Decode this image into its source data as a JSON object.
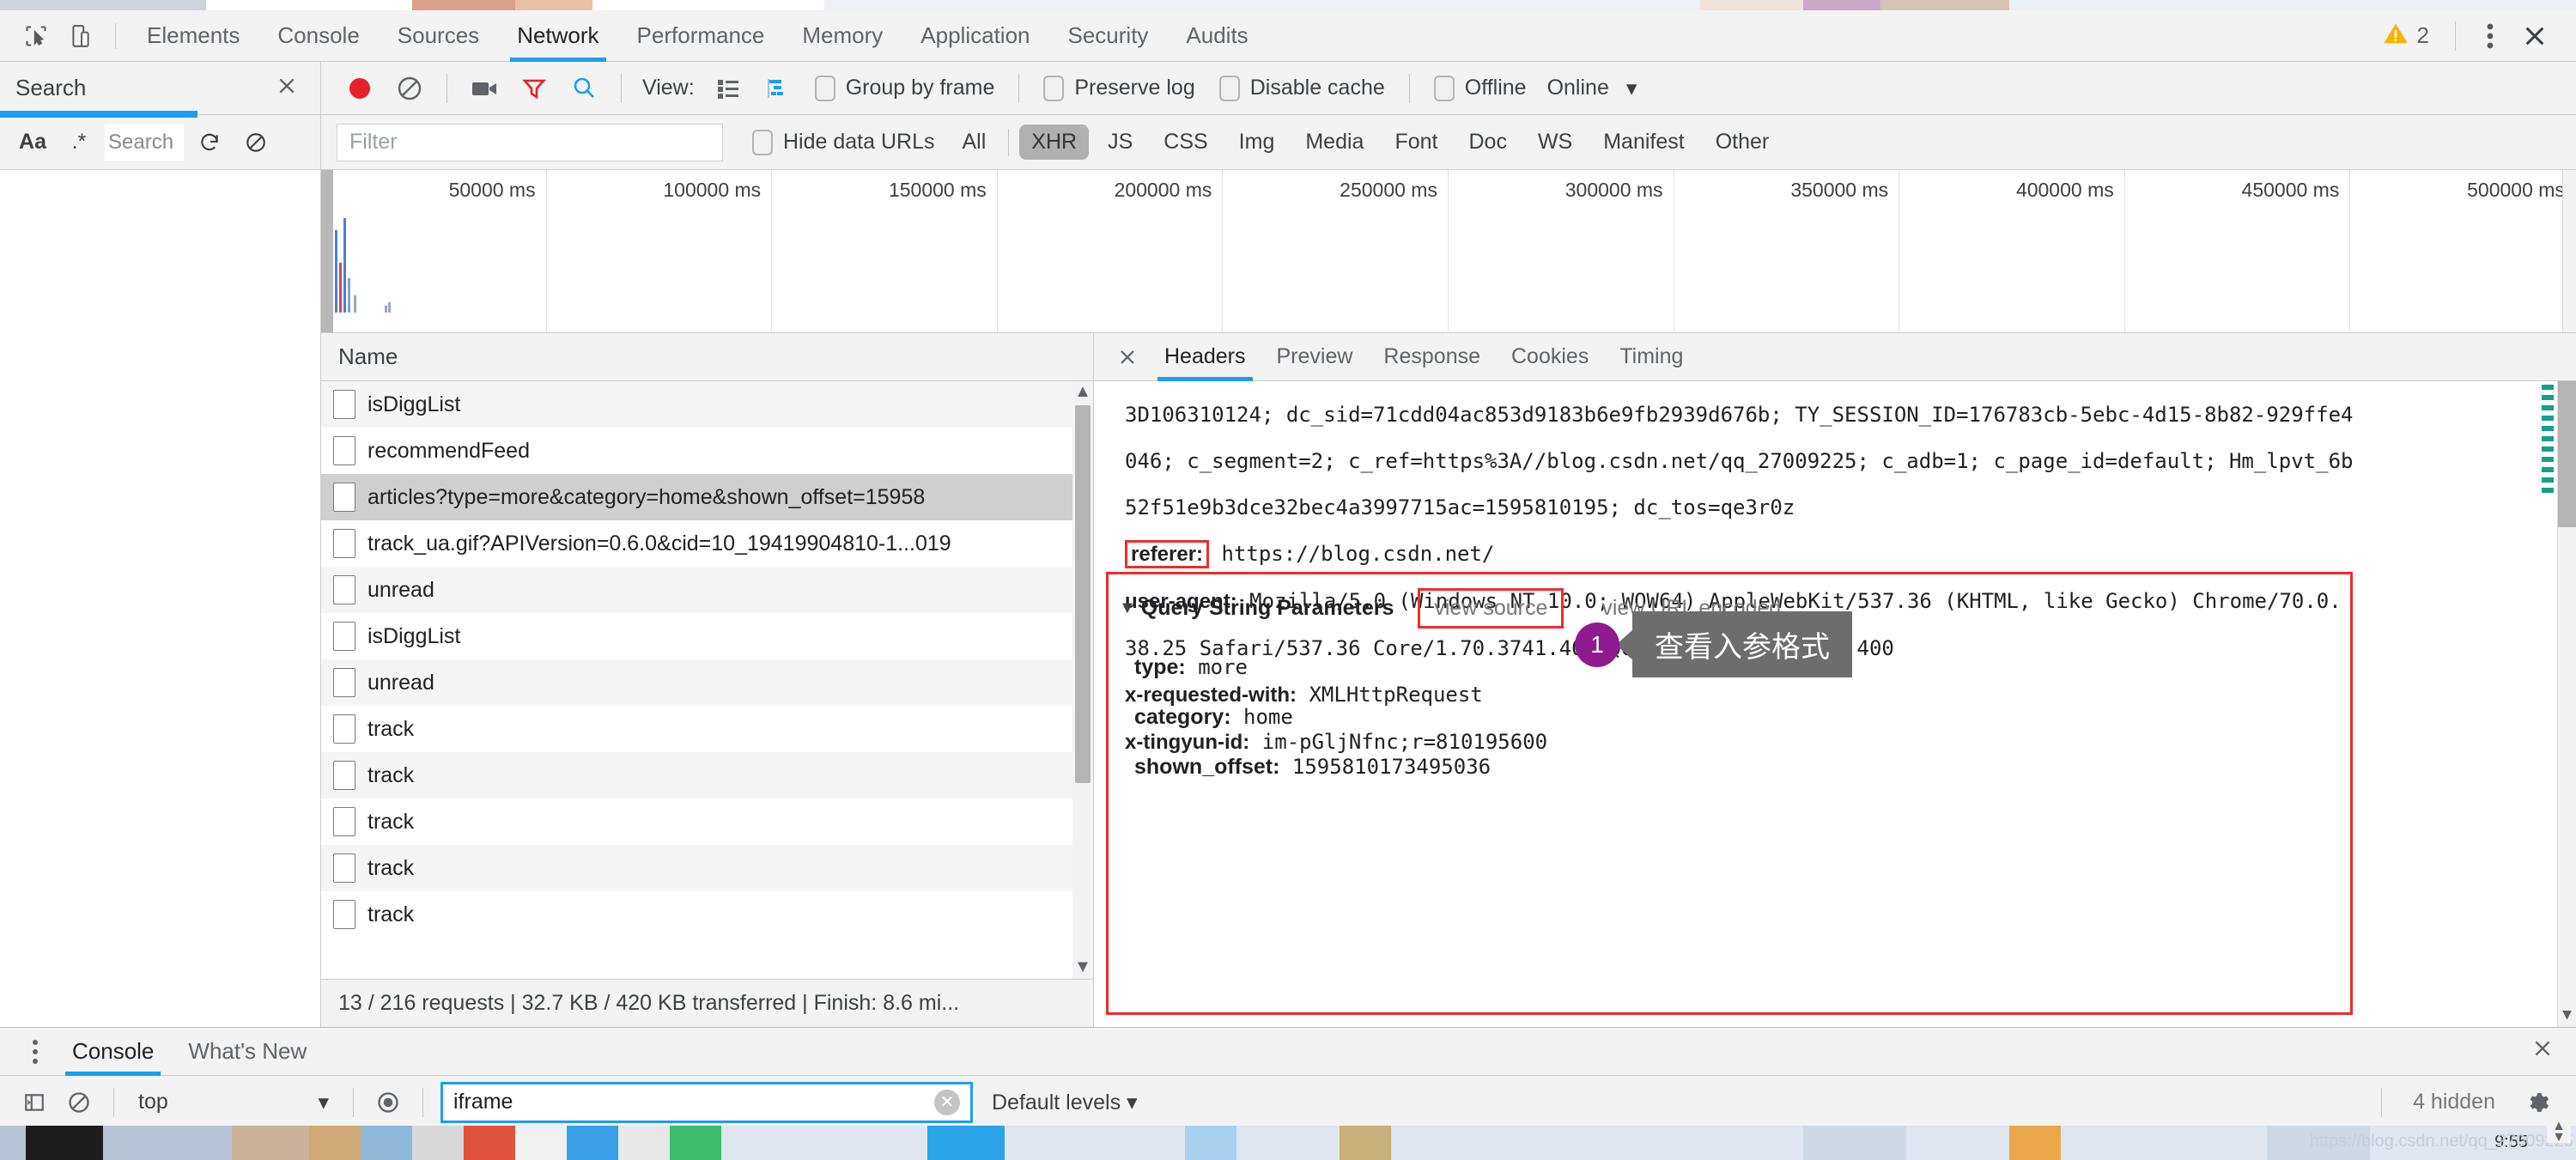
{
  "window": {
    "main_tabs": [
      {
        "label": "Elements",
        "active": false
      },
      {
        "label": "Console",
        "active": false
      },
      {
        "label": "Sources",
        "active": false
      },
      {
        "label": "Network",
        "active": true
      },
      {
        "label": "Performance",
        "active": false
      },
      {
        "label": "Memory",
        "active": false
      },
      {
        "label": "Application",
        "active": false
      },
      {
        "label": "Security",
        "active": false
      },
      {
        "label": "Audits",
        "active": false
      }
    ],
    "inspect_icon": "inspect-element-icon",
    "device_icon": "device-toolbar-icon",
    "warning_icon": "warning-triangle-icon",
    "warning_count": "2",
    "more_icon": "more-vertical-icon",
    "close_icon": "close-icon"
  },
  "search_pane": {
    "title": "Search",
    "close_icon": "close-icon",
    "match_case_label": "Aa",
    "regex_label": ".*",
    "query_value": "Search",
    "refresh_icon": "refresh-icon",
    "clear_icon": "clear-icon"
  },
  "network_toolbar": {
    "record_icon": "record-circle-icon",
    "clear_icon": "clear-no-entry-icon",
    "screenshot_icon": "camera-icon",
    "filter_icon": "funnel-icon",
    "search_icon": "magnifier-icon",
    "view_label": "View:",
    "view_list_icon": "list-view-icon",
    "view_waterfall_icon": "waterfall-view-icon",
    "group_by_frame": "Group by frame",
    "preserve_log": "Preserve log",
    "disable_cache": "Disable cache",
    "offline": "Offline",
    "throttling_value": "Online",
    "throttling_caret": "chevron-down-icon"
  },
  "filter_bar": {
    "filter_placeholder": "Filter",
    "filter_value": "",
    "hide_data_urls": "Hide data URLs",
    "types": [
      {
        "label": "All",
        "active": false
      },
      {
        "label": "XHR",
        "active": true
      },
      {
        "label": "JS",
        "active": false
      },
      {
        "label": "CSS",
        "active": false
      },
      {
        "label": "Img",
        "active": false
      },
      {
        "label": "Media",
        "active": false
      },
      {
        "label": "Font",
        "active": false
      },
      {
        "label": "Doc",
        "active": false
      },
      {
        "label": "WS",
        "active": false
      },
      {
        "label": "Manifest",
        "active": false
      },
      {
        "label": "Other",
        "active": false
      }
    ]
  },
  "overview": {
    "ticks": [
      "50000 ms",
      "100000 ms",
      "150000 ms",
      "200000 ms",
      "250000 ms",
      "300000 ms",
      "350000 ms",
      "400000 ms",
      "450000 ms",
      "500000 ms"
    ]
  },
  "request_list": {
    "column_header": "Name",
    "rows": [
      {
        "name": "isDiggList",
        "selected": false
      },
      {
        "name": "recommendFeed",
        "selected": false
      },
      {
        "name": "articles?type=more&category=home&shown_offset=15958",
        "selected": true
      },
      {
        "name": "track_ua.gif?APIVersion=0.6.0&cid=10_19419904810-1...019",
        "selected": false
      },
      {
        "name": "unread",
        "selected": false
      },
      {
        "name": "isDiggList",
        "selected": false
      },
      {
        "name": "unread",
        "selected": false
      },
      {
        "name": "track",
        "selected": false
      },
      {
        "name": "track",
        "selected": false
      },
      {
        "name": "track",
        "selected": false
      },
      {
        "name": "track",
        "selected": false
      },
      {
        "name": "track",
        "selected": false
      }
    ],
    "status": "13 / 216 requests  |  32.7 KB / 420 KB transferred  |  Finish: 8.6 mi..."
  },
  "detail_pane": {
    "close_icon": "close-icon",
    "tabs": [
      {
        "label": "Headers",
        "active": true
      },
      {
        "label": "Preview",
        "active": false
      },
      {
        "label": "Response",
        "active": false
      },
      {
        "label": "Cookies",
        "active": false
      },
      {
        "label": "Timing",
        "active": false
      }
    ],
    "headers_lines": [
      "3D106310124; dc_sid=71cdd04ac853d9183b6e9fb2939d676b; TY_SESSION_ID=176783cb-5ebc-4d15-8b82-929ffe4",
      "046; c_segment=2; c_ref=https%3A//blog.csdn.net/qq_27009225; c_adb=1; c_page_id=default; Hm_lpvt_6b",
      "52f51e9b3dce32bec4a3997715ac=1595810195; dc_tos=qe3r0z"
    ],
    "headers_pairs": [
      {
        "key": "referer:",
        "value": "https://blog.csdn.net/",
        "boxed": true
      },
      {
        "key": "user-agent:",
        "value": "Mozilla/5.0 (Windows NT 10.0; WOW64) AppleWebKit/537.36 (KHTML, like Gecko) Chrome/70.0.",
        "boxed": false
      },
      {
        "key": "",
        "value": "38.25 Safari/537.36 Core/1.70.3741.400 QQBrowser/10.5.3863.400",
        "boxed": false
      },
      {
        "key": "x-requested-with:",
        "value": "XMLHttpRequest",
        "boxed": false
      },
      {
        "key": "x-tingyun-id:",
        "value": "im-pGljNfnc;r=810195600",
        "boxed": false
      }
    ],
    "query_section": {
      "caret": "triangle-down-icon",
      "title": "Query String Parameters",
      "view_source": "view source",
      "view_url_encoded": "view URL encoded",
      "params": [
        {
          "key": "type:",
          "value": "more"
        },
        {
          "key": "category:",
          "value": "home"
        },
        {
          "key": "shown_offset:",
          "value": "1595810173495036"
        }
      ]
    }
  },
  "annotation": {
    "number": "1",
    "text": "查看入参格式",
    "badge_color": "#8e1a8e",
    "bubble_color": "#6d6d6d",
    "highlight_color": "#ef2b2b"
  },
  "drawer": {
    "menu_icon": "more-vertical-icon",
    "tabs": [
      {
        "label": "Console",
        "active": true
      },
      {
        "label": "What's New",
        "active": false
      }
    ],
    "close_icon": "close-icon",
    "sidebar_icon": "show-console-sidebar-icon",
    "clear_icon": "clear-console-icon",
    "context_value": "top",
    "context_caret": "chevron-down-icon",
    "eye_icon": "live-expression-icon",
    "filter_value": "iframe",
    "filter_clear_icon": "clear-input-icon",
    "levels_label": "Default levels",
    "levels_caret": "chevron-down-icon",
    "hidden_label": "4 hidden",
    "settings_icon": "gear-icon"
  },
  "desktop": {
    "status_url": "https://blog.csdn.net/qq_27009225",
    "clock": "9:55"
  },
  "colors": {
    "accent": "#1a9ff0",
    "toolbar_bg": "#f3f3f3",
    "highlight_red": "#ef2b2b",
    "selected_row": "#cfcfcf",
    "record_red": "#e8202a",
    "warning_yellow": "#f5b400"
  }
}
